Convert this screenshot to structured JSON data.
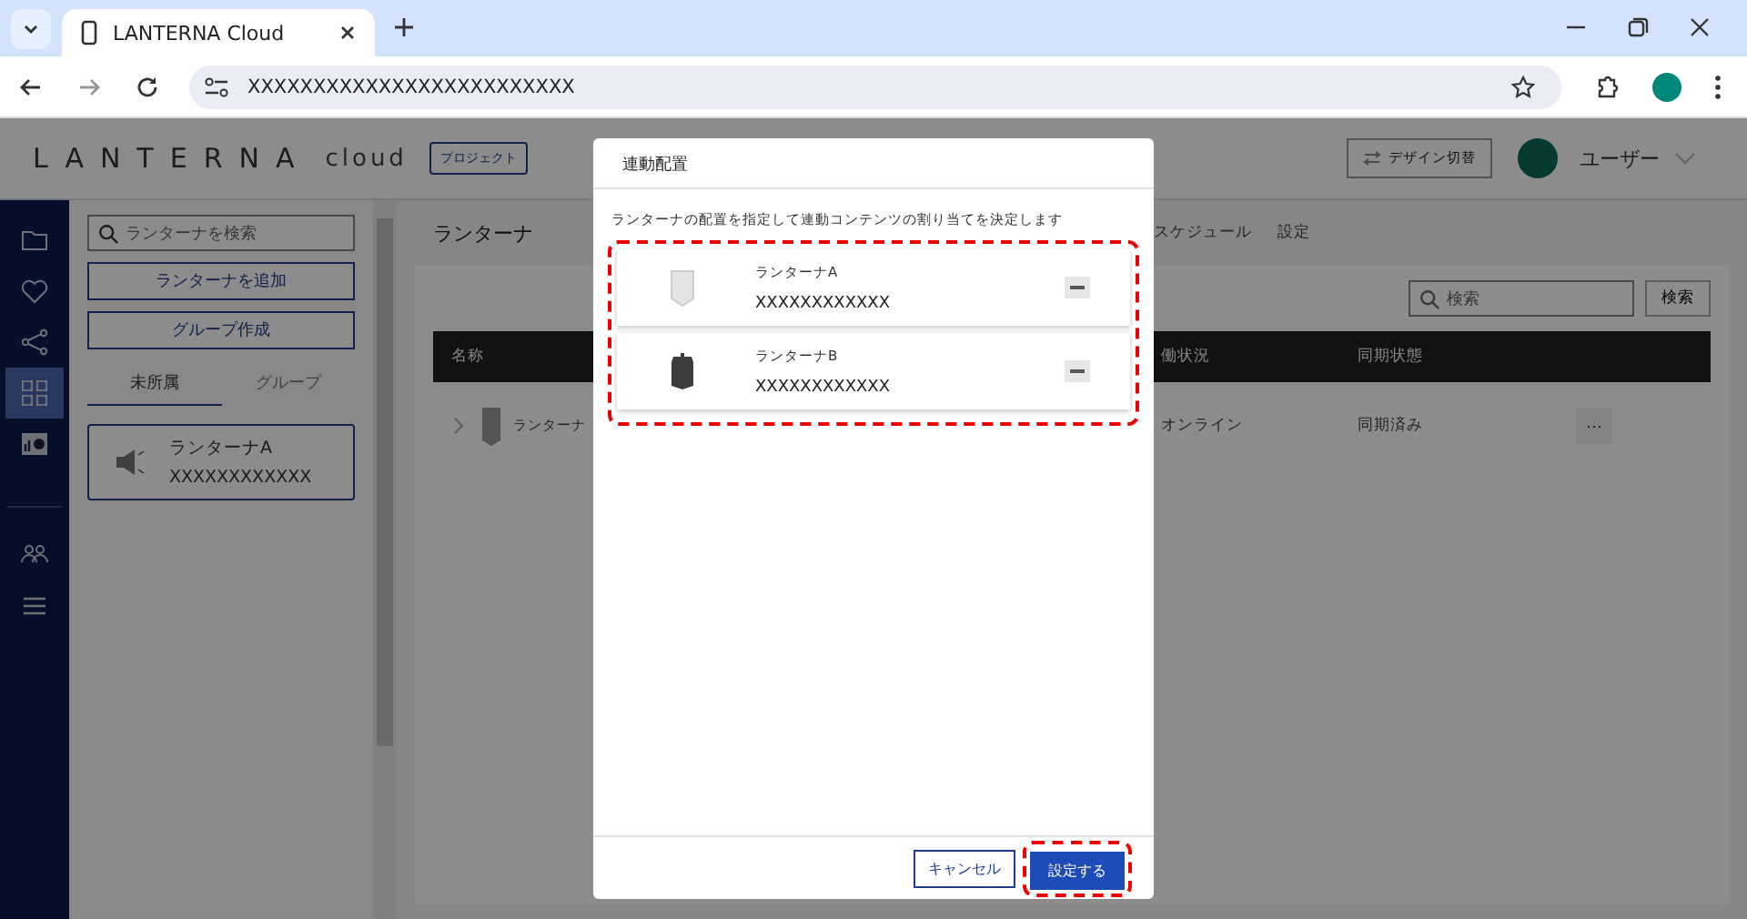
{
  "browser": {
    "tab_title": "LANTERNA Cloud",
    "url": "XXXXXXXXXXXXXXXXXXXXXXXXX"
  },
  "header": {
    "logo": "LANTERNA",
    "logo_sub": "cloud",
    "project_badge": "プロジェクト",
    "design_switch": "デザイン切替",
    "user": "ユーザー"
  },
  "nav_items": [
    {
      "kind": "folder",
      "selected": false
    },
    {
      "kind": "heart",
      "selected": false
    },
    {
      "kind": "share",
      "selected": false
    },
    {
      "kind": "grid",
      "selected": true
    },
    {
      "kind": "chart",
      "selected": false
    },
    {
      "kind": "people",
      "selected": false
    },
    {
      "kind": "list",
      "selected": false
    }
  ],
  "left_panel": {
    "search_placeholder": "ランターナを検索",
    "buttons": [
      "ランターナを追加",
      "グループ作成"
    ],
    "tabs": [
      {
        "label": "未所属",
        "selected": true
      },
      {
        "label": "グループ",
        "selected": false
      }
    ],
    "items": [
      {
        "name": "ランターナA",
        "serial": "XXXXXXXXXXXX"
      }
    ]
  },
  "main": {
    "title": "ランターナ",
    "tabs": [
      "スケジュール",
      "設定"
    ],
    "search_placeholder": "検索",
    "search_button": "検索",
    "columns": [
      "名称",
      "働状況",
      "同期状態"
    ],
    "rows": [
      {
        "name": "ランターナ",
        "status": "オンライン",
        "sync": "同期済み",
        "menu": "···"
      }
    ]
  },
  "dialog": {
    "title": "連動配置",
    "description": "ランターナの配置を指定して連動コンテンツの割り当てを決定します",
    "list_highlighted": true,
    "lanterns": [
      {
        "name": "ランターナA",
        "serial": "XXXXXXXXXXXX",
        "kind": "white"
      },
      {
        "name": "ランターナB",
        "serial": "XXXXXXXXXXXX",
        "kind": "black"
      }
    ],
    "cancel_button": "キャンセル",
    "confirm_button": "設定する",
    "confirm_highlighted": true
  }
}
